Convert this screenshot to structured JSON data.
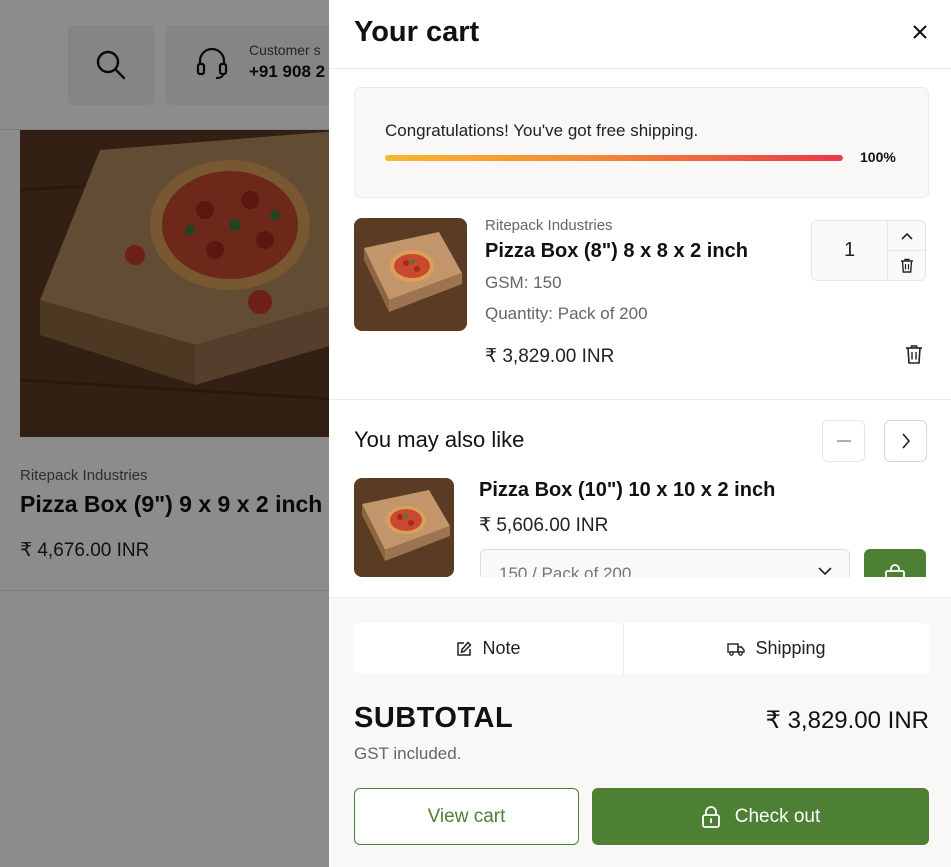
{
  "colors": {
    "brand_green": "#4d7f34",
    "progress_start": "#f8b72b",
    "progress_end": "#e93a48",
    "overlay": "rgba(0,0,0,0.45)"
  },
  "background_page": {
    "support_label": "Customer s",
    "support_phone": "+91 908 2",
    "product": {
      "brand": "Ritepack Industries",
      "title": "Pizza Box (9\") 9 x 9 x 2 inch",
      "price": "₹ 4,676.00 INR"
    }
  },
  "cart": {
    "title": "Your cart",
    "close_icon": "close-icon",
    "shipping_bar": {
      "message": "Congratulations! You've got free shipping.",
      "percent_label": "100%",
      "progress": 1.0
    },
    "items": [
      {
        "vendor": "Ritepack Industries",
        "title": "Pizza Box (8\") 8 x 8 x 2 inch",
        "gsm": "GSM: 150",
        "quantity_option": "Quantity: Pack of 200",
        "price": "₹ 3,829.00 INR",
        "qty": "1"
      }
    ],
    "recommendations": {
      "title": "You may also like",
      "products": [
        {
          "title": "Pizza Box (10\") 10 x 10 x 2 inch",
          "price": "₹ 5,606.00 INR",
          "variant": "150 / Pack of 200"
        }
      ]
    },
    "footer": {
      "note_label": "Note",
      "shipping_label": "Shipping",
      "subtotal_label": "SUBTOTAL",
      "subtotal_value": "₹ 3,829.00 INR",
      "tax_note": "GST included.",
      "view_cart_label": "View cart",
      "checkout_label": "Check out"
    }
  }
}
